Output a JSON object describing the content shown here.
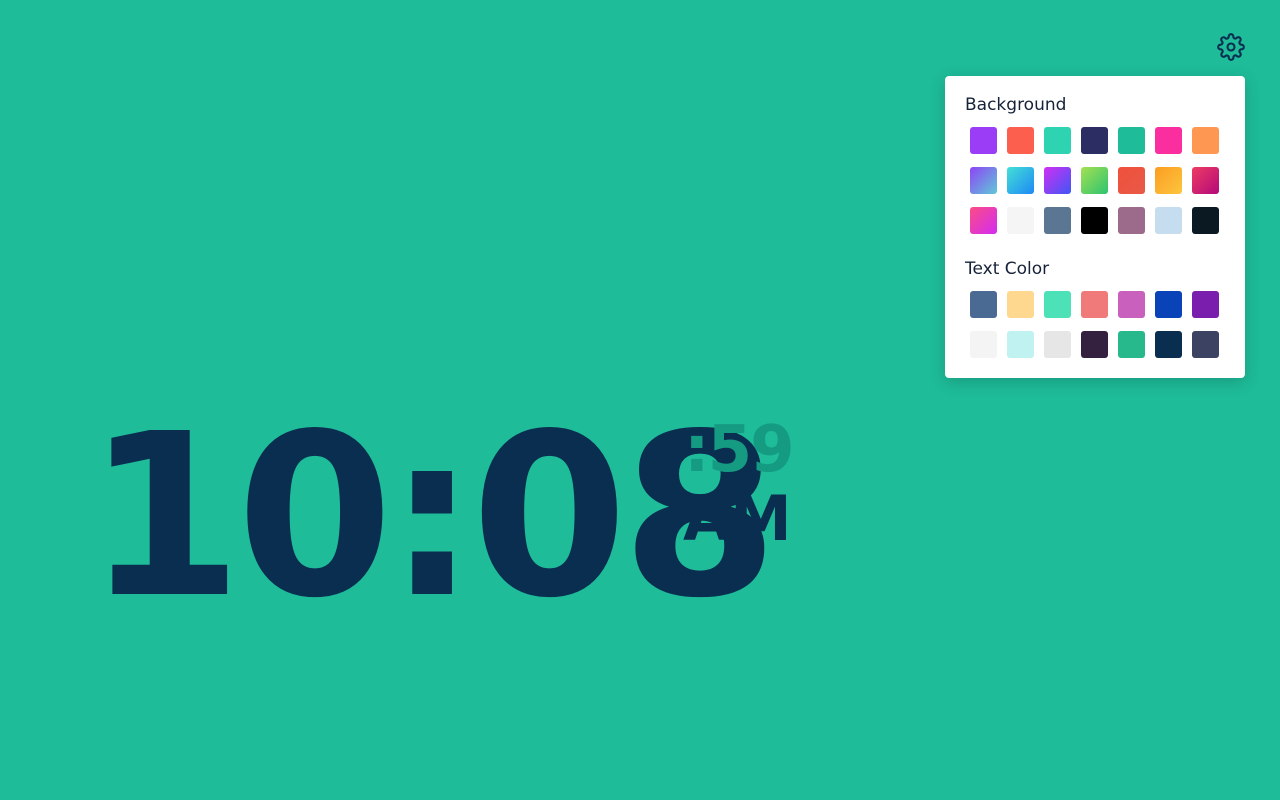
{
  "clock": {
    "time": "10:08",
    "seconds": ":59",
    "period": "AM"
  },
  "settings": {
    "icon": "gear-icon",
    "background_heading": "Background",
    "text_color_heading": "Text Color",
    "background_swatches": [
      "#9b3cf7",
      "#fd5f4f",
      "#2ed3b1",
      "#2b2d63",
      "#1ebc99",
      "#fb2ea0",
      "#fe9752",
      "linear-gradient(135deg,#8e44f5,#5fc9d8)",
      "linear-gradient(135deg,#43e0d6,#1e88f5)",
      "linear-gradient(135deg,#d12ff3,#3f56f5)",
      "linear-gradient(135deg,#a4e052,#2cc46f)",
      "linear-gradient(135deg,#f1503c,#e65a47)",
      "linear-gradient(135deg,#fb9d21,#fdc53e)",
      "linear-gradient(135deg,#ee3c63,#b3097a)",
      "linear-gradient(135deg,#fb4c84,#d32cf3)",
      "#f5f5f5",
      "#5b7693",
      "#000000",
      "#9c6a8a",
      "#c6ddf0",
      "#0b1a22"
    ],
    "text_swatches": [
      "#4a6a94",
      "#fed88f",
      "#4ce1b6",
      "#f07a7a",
      "#c960bd",
      "#0a42b8",
      "#7a1fad",
      "#f4f4f4",
      "#c0f2f1",
      "#e6e6e6",
      "#34213f",
      "#27b98b",
      "#0a2e50",
      "#3c4262"
    ],
    "accent": "#0a2e50"
  }
}
